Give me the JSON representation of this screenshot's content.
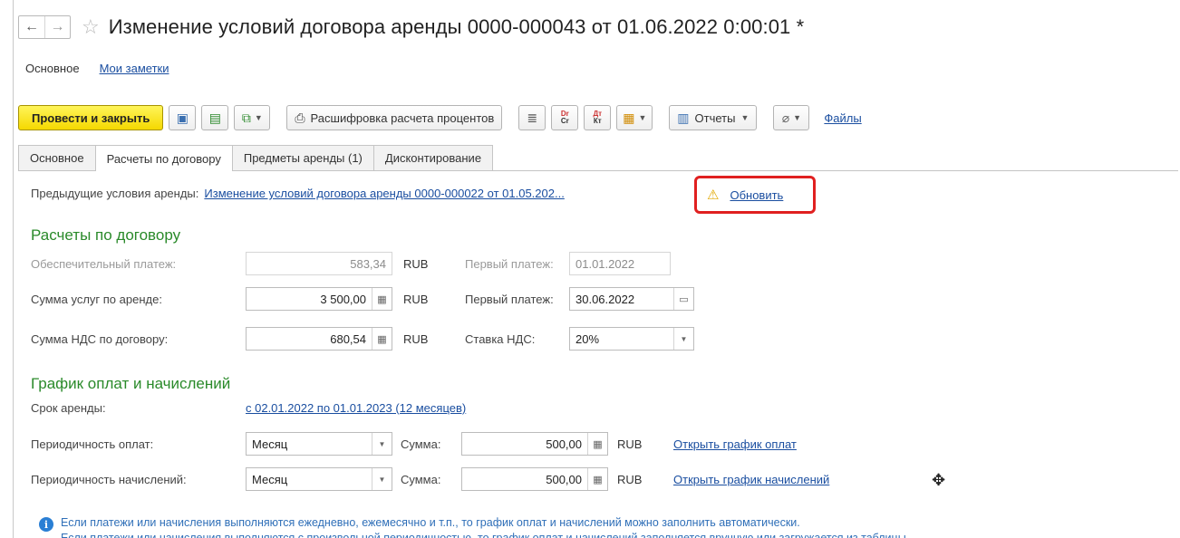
{
  "window": {
    "title": "Изменение условий договора аренды 0000-000043 от 01.06.2022 0:00:01 *",
    "nav_back_icon": "arrow-left-icon",
    "nav_forward_icon": "arrow-right-icon",
    "favorite_icon": "star-icon"
  },
  "subnav": {
    "main": "Основное",
    "notes": "Мои заметки"
  },
  "toolbar": {
    "post_close": "Провести и закрыть",
    "interest_breakdown": "Расшифровка расчета процентов",
    "reports": "Отчеты",
    "files": "Файлы"
  },
  "tabs": [
    {
      "label": "Основное",
      "active": false
    },
    {
      "label": "Расчеты по договору",
      "active": true
    },
    {
      "label": "Предметы аренды (1)",
      "active": false
    },
    {
      "label": "Дисконтирование",
      "active": false
    }
  ],
  "previous": {
    "label": "Предыдущие условия аренды:",
    "link": "Изменение условий договора аренды 0000-000022 от 01.05.202...",
    "refresh": "Обновить"
  },
  "settlements": {
    "title": "Расчеты по договору",
    "security_label": "Обеспечительный платеж:",
    "security_value": "583,34",
    "security_currency": "RUB",
    "security_first_label": "Первый платеж:",
    "security_first_value": "01.01.2022",
    "services_label": "Сумма услуг по аренде:",
    "services_value": "3 500,00",
    "services_currency": "RUB",
    "services_first_label": "Первый платеж:",
    "services_first_value": "30.06.2022",
    "vat_label": "Сумма НДС по договору:",
    "vat_value": "680,54",
    "vat_currency": "RUB",
    "vat_rate_label": "Ставка НДС:",
    "vat_rate_value": "20%"
  },
  "schedule": {
    "title": "График оплат и начислений",
    "term_label": "Срок аренды:",
    "term_value": "с 02.01.2022 по 01.01.2023 (12 месяцев)",
    "pay_period_label": "Периодичность оплат:",
    "pay_period_value": "Месяц",
    "pay_sum_label": "Сумма:",
    "pay_sum_value": "500,00",
    "pay_currency": "RUB",
    "pay_open": "Открыть график оплат",
    "acc_period_label": "Периодичность начислений:",
    "acc_period_value": "Месяц",
    "acc_sum_label": "Сумма:",
    "acc_sum_value": "500,00",
    "acc_currency": "RUB",
    "acc_open": "Открыть график начислений"
  },
  "info": {
    "line1": "Если платежи или начисления выполняются ежедневно, ежемесячно и т.п., то график оплат и начислений можно заполнить автоматически.",
    "line2": "Если платежи или начисления выполняются с произвольной периодичностью, то график оплат и начислений заполняется вручную или загружается из таблицы."
  },
  "colors": {
    "section_title": "#2a8a2a",
    "link": "#1a4ea0",
    "primary_button": "#f5d800",
    "highlight": "#e02020",
    "info": "#2f6fb8"
  }
}
